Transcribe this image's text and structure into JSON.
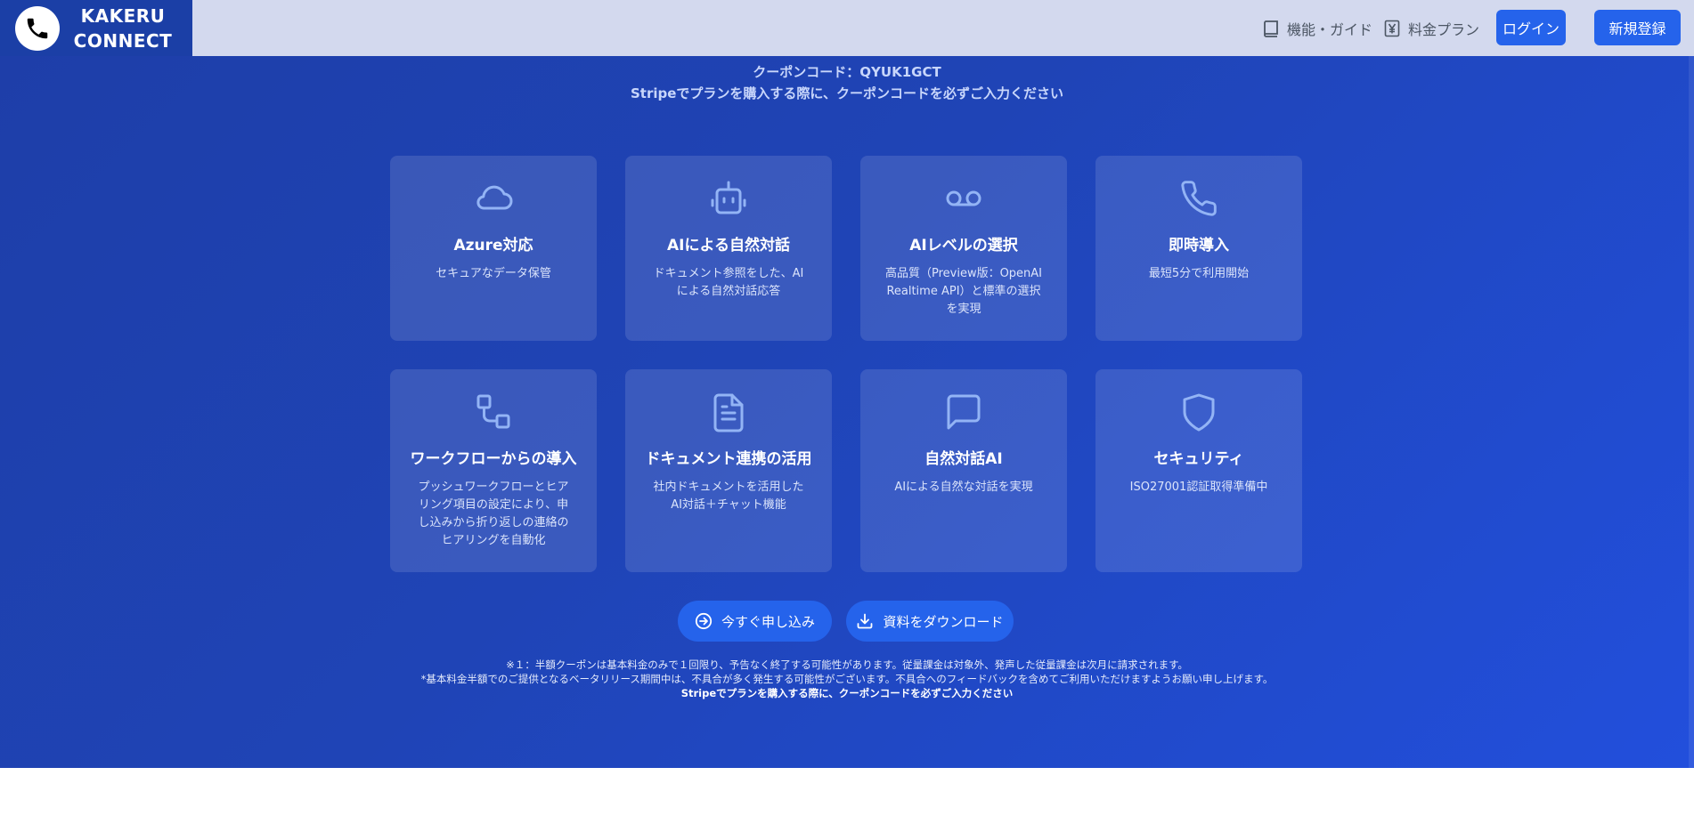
{
  "header": {
    "brand_line1": "KAKERU",
    "brand_line2": "CONNECT",
    "nav_guide": "機能・ガイド",
    "nav_pricing": "料金プラン",
    "login": "ログイン",
    "signup": "新規登録"
  },
  "coupon": {
    "code_line": "クーポンコード：QYUK1GCT",
    "instruction": "Stripeでプランを購入する際に、クーポンコードを必ずご入力ください"
  },
  "features": [
    {
      "icon": "cloud-icon",
      "title": "Azure対応",
      "desc": "セキュアなデータ保管"
    },
    {
      "icon": "robot-icon",
      "title": "AIによる自然対話",
      "desc": "ドキュメント参照をした、AIによる自然対話応答"
    },
    {
      "icon": "voicemail-icon",
      "title": "AIレベルの選択",
      "desc": "高品質（Preview版：OpenAI Realtime API）と標準の選択を実現"
    },
    {
      "icon": "phone-icon",
      "title": "即時導入",
      "desc": "最短5分で利用開始"
    },
    {
      "icon": "workflow-icon",
      "title": "ワークフローからの導入",
      "desc": "プッシュワークフローとヒアリング項目の設定により、申し込みから折り返しの連絡のヒアリングを自動化"
    },
    {
      "icon": "document-icon",
      "title": "ドキュメント連携の活用",
      "desc": "社内ドキュメントを活用したAI対話＋チャット機能"
    },
    {
      "icon": "chat-icon",
      "title": "自然対話AI",
      "desc": "AIによる自然な対話を実現"
    },
    {
      "icon": "shield-icon",
      "title": "セキュリティ",
      "desc": "ISO27001認証取得準備中"
    }
  ],
  "cta": {
    "apply": "今すぐ申し込み",
    "download": "資料をダウンロード"
  },
  "notes": {
    "line1": "※１：半額クーポンは基本料金のみで１回限り、予告なく終了する可能性があります。従量課金は対象外、発声した従量課金は次月に請求されます。",
    "line2": "*基本料金半額でのご提供となるベータリリース期間中は、不具合が多く発生する可能性がございます。不具合へのフィードバックを含めてご利用いただけますようお願い申し上げます。",
    "line3": "Stripeでプランを購入する際に、クーポンコードを必ずご入力ください"
  },
  "colors": {
    "accent": "#2563eb",
    "hero": "#1f44b6",
    "icon": "#93b4f5"
  }
}
